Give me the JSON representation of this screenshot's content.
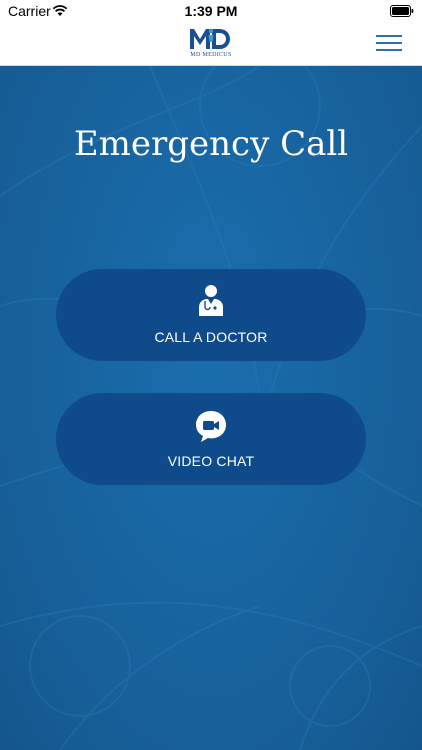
{
  "status_bar": {
    "carrier": "Carrier",
    "time": "1:39 PM",
    "wifi_icon": "wifi-icon",
    "battery_icon": "battery-icon"
  },
  "header": {
    "logo_text": "MD MEDICUS",
    "logo_icon": "md-medicus-logo",
    "menu_icon": "hamburger-menu-icon"
  },
  "main": {
    "title": "Emergency Call",
    "actions": [
      {
        "label": "CALL A DOCTOR",
        "icon": "doctor-icon"
      },
      {
        "label": "VIDEO CHAT",
        "icon": "video-chat-icon"
      }
    ]
  },
  "colors": {
    "background": "#1767a3",
    "button": "#0f4b8a",
    "brand": "#1c4f8f",
    "menu": "#2f6fb0"
  }
}
